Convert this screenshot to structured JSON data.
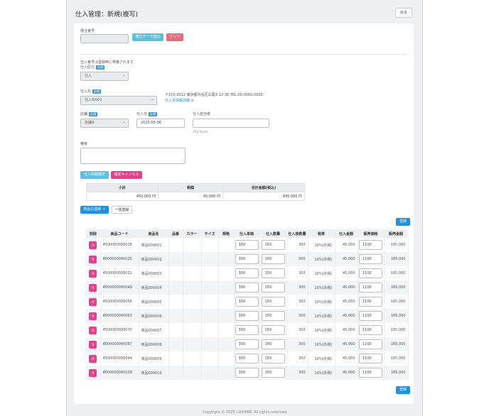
{
  "header": {
    "title": "仕入管理：新規(複写)",
    "back_label": "戻る"
  },
  "order": {
    "label": "発注番号",
    "value": "",
    "load_label": "発注データ読込",
    "clear_label": "クリア"
  },
  "note_auto": "仕入番号は登録時に発番されます",
  "required_badge": "必須",
  "category": {
    "label": "仕入区分",
    "value": "仕入"
  },
  "supplier": {
    "label": "仕入先",
    "value": "仕入先001",
    "address": "〒150-0012 東京都渋谷区広尾3-12-36 TEL:00-0000-0000",
    "detail_link": "仕入先情報詳細",
    "detail_icon": "external-link-icon"
  },
  "store": {
    "label": "店舗",
    "value": "店舗A"
  },
  "date": {
    "label": "仕入日",
    "value": "2025-05-06"
  },
  "person": {
    "label": "仕入担当者",
    "value": "",
    "hint": "30文字以内"
  },
  "remarks": {
    "label": "備考",
    "value": ""
  },
  "actions": {
    "confirm_label": "仕入情報確定",
    "cancel_label": "確定キャンセル"
  },
  "summary": {
    "headers": [
      "小計",
      "税額",
      "合計金額(税込)"
    ],
    "values": [
      "450,000 円",
      "45,000 円",
      "495,000 円"
    ]
  },
  "items_toolbar": {
    "add_label": "商品の登録 ＋",
    "bulk_label": "一括登録",
    "register_label": "登録"
  },
  "table": {
    "headers": [
      "削除",
      "商品コード",
      "商品名",
      "品番",
      "カラー",
      "サイズ",
      "規格",
      "仕入単価",
      "仕入数量",
      "仕入後数量",
      "税率",
      "仕入金額",
      "販売価格",
      "販売金額"
    ],
    "rows": [
      {
        "code": "4500000000018",
        "name": "商品000001",
        "unit_price": "300",
        "qty": "150",
        "after_qty": "300",
        "tax": "10%(外税)",
        "amount": "45,000",
        "sale_price": "1100",
        "sale_amount": "165,000"
      },
      {
        "code": "4500000000025",
        "name": "商品000002",
        "unit_price": "300",
        "qty": "150",
        "after_qty": "300",
        "tax": "10%(外税)",
        "amount": "45,000",
        "sale_price": "1100",
        "sale_amount": "165,000"
      },
      {
        "code": "4500000000032",
        "name": "商品000003",
        "unit_price": "300",
        "qty": "150",
        "after_qty": "300",
        "tax": "10%(外税)",
        "amount": "45,000",
        "sale_price": "1100",
        "sale_amount": "165,000"
      },
      {
        "code": "4500000000049",
        "name": "商品000004",
        "unit_price": "300",
        "qty": "150",
        "after_qty": "300",
        "tax": "10%(外税)",
        "amount": "45,000",
        "sale_price": "1100",
        "sale_amount": "165,000"
      },
      {
        "code": "4500000000056",
        "name": "商品000005",
        "unit_price": "300",
        "qty": "150",
        "after_qty": "300",
        "tax": "10%(外税)",
        "amount": "45,000",
        "sale_price": "1100",
        "sale_amount": "165,000"
      },
      {
        "code": "4500000000063",
        "name": "商品000006",
        "unit_price": "300",
        "qty": "150",
        "after_qty": "300",
        "tax": "10%(外税)",
        "amount": "45,000",
        "sale_price": "1100",
        "sale_amount": "165,000"
      },
      {
        "code": "4500000000070",
        "name": "商品000007",
        "unit_price": "300",
        "qty": "150",
        "after_qty": "300",
        "tax": "10%(外税)",
        "amount": "45,000",
        "sale_price": "1100",
        "sale_amount": "165,000"
      },
      {
        "code": "4500000000087",
        "name": "商品000008",
        "unit_price": "300",
        "qty": "150",
        "after_qty": "300",
        "tax": "10%(外税)",
        "amount": "45,000",
        "sale_price": "1100",
        "sale_amount": "165,000"
      },
      {
        "code": "4500000000094",
        "name": "商品000009",
        "unit_price": "300",
        "qty": "150",
        "after_qty": "300",
        "tax": "10%(外税)",
        "amount": "45,000",
        "sale_price": "1100",
        "sale_amount": "165,000"
      },
      {
        "code": "4500000000100",
        "name": "商品000010",
        "unit_price": "300",
        "qty": "150",
        "after_qty": "300",
        "tax": "10%(外税)",
        "amount": "45,000",
        "sale_price": "1100",
        "sale_amount": "165,000"
      }
    ]
  },
  "footer": "Copyright © 2025 CASHIER. All rights reserved."
}
